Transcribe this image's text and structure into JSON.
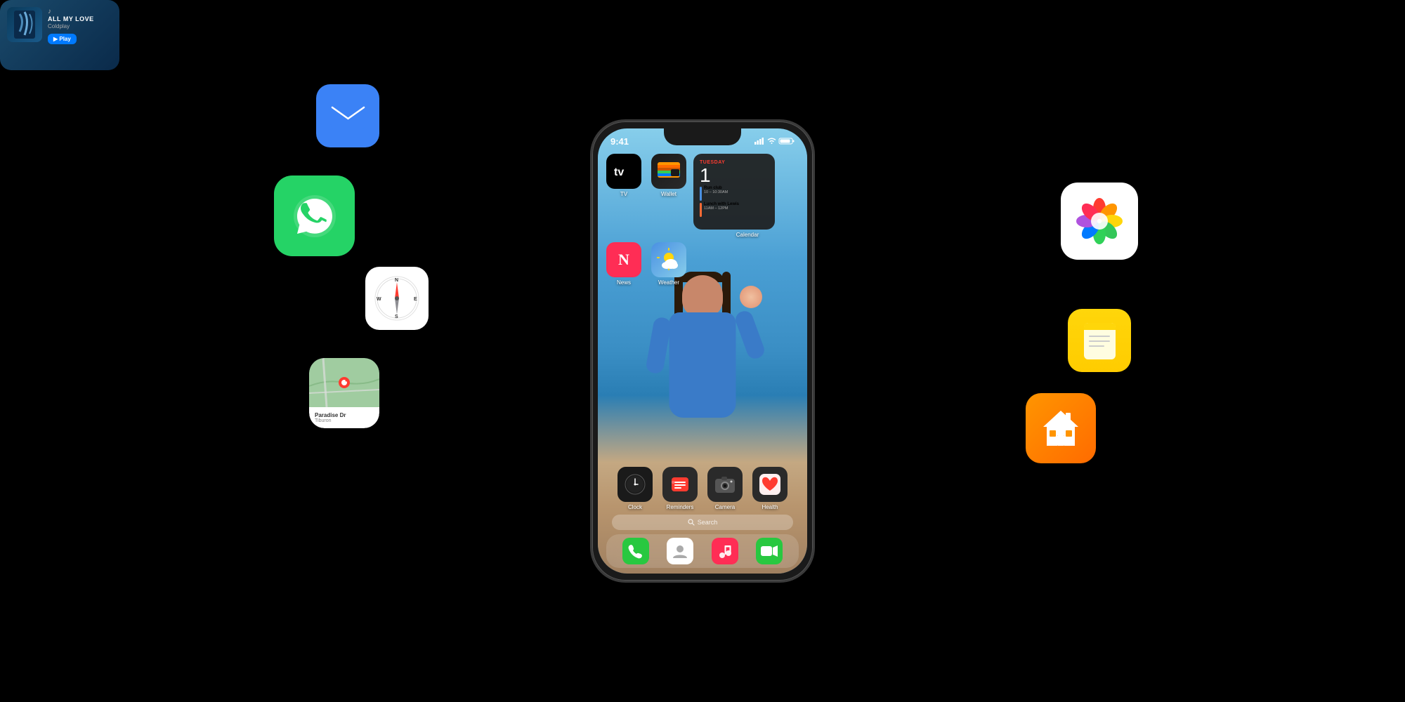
{
  "page": {
    "background": "#000000"
  },
  "phone": {
    "status_bar": {
      "time": "9:41",
      "signal_bars": "▌▌▌▌",
      "wifi": "WiFi",
      "battery": "Battery"
    },
    "apps": {
      "tv": {
        "label": "TV",
        "icon": "tv"
      },
      "wallet": {
        "label": "Wallet",
        "icon": "wallet"
      },
      "news": {
        "label": "News",
        "icon": "news"
      },
      "weather": {
        "label": "Weather",
        "icon": "weather"
      },
      "calendar": {
        "label": "Calendar",
        "icon": "calendar"
      },
      "clock": {
        "label": "Clock",
        "icon": "clock"
      },
      "reminders": {
        "label": "Reminders",
        "icon": "reminders"
      },
      "camera": {
        "label": "Camera",
        "icon": "camera"
      },
      "health": {
        "label": "Health",
        "icon": "health"
      }
    },
    "calendar_widget": {
      "day": "TUESDAY",
      "date": "1",
      "event1_title": "Run club",
      "event1_time": "10 – 10:30AM",
      "event1_color": "#4a90e2",
      "event2_title": "Lunch with Lewis",
      "event2_time": "11AM – 12PM",
      "event2_color": "#ff6b35"
    },
    "search_bar": {
      "placeholder": "Search"
    },
    "dock": {
      "phone_label": "Phone",
      "contacts_label": "Contacts",
      "music_label": "Music",
      "facetime_label": "FaceTime"
    }
  },
  "floating_apps": {
    "mail": {
      "label": "Mail"
    },
    "whatsapp": {
      "label": "WhatsApp"
    },
    "safari": {
      "label": "Safari"
    },
    "maps": {
      "label": "Maps",
      "location": "Paradise Dr",
      "sublocation": "Tiburon"
    },
    "music_widget": {
      "song": "ALL MY LOVE",
      "artist": "Coldplay",
      "play_label": "▶ Play"
    },
    "photos": {
      "label": "Photos"
    },
    "notes": {
      "label": "Notes"
    },
    "home": {
      "label": "Home"
    }
  }
}
